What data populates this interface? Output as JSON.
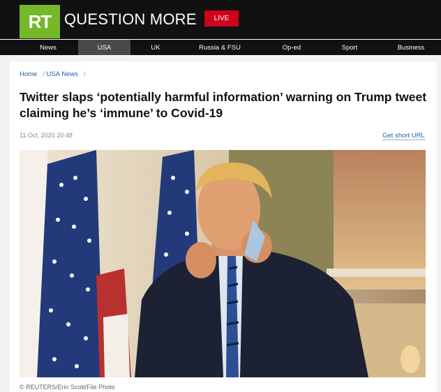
{
  "header": {
    "logo_text": "RT",
    "tagline": "QUESTION MORE",
    "live_label": "LIVE"
  },
  "nav": {
    "items": [
      "News",
      "USA",
      "UK",
      "Russia & FSU",
      "Op-ed",
      "Sport",
      "Business"
    ],
    "active": "USA"
  },
  "breadcrumb": {
    "home": "Home",
    "section": "USA News"
  },
  "article": {
    "headline": "Twitter slaps ‘potentially harmful information’ warning on Trump tweet claiming he’s ‘immune’ to Covid-19",
    "date": "11 Oct, 2020 20:48",
    "short_url_label": "Get short URL",
    "photo_caption": "© REUTERS/Erin Scott/File Photo"
  },
  "colors": {
    "header_bg": "#111111",
    "logo_green": "#77b82a",
    "live_red": "#d0021b",
    "link_blue": "#1f5fa8"
  }
}
